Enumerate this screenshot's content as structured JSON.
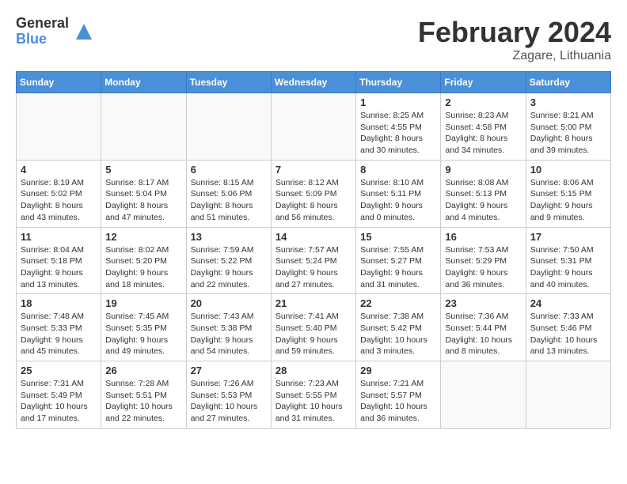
{
  "logo": {
    "general": "General",
    "blue": "Blue"
  },
  "title": {
    "month_year": "February 2024",
    "location": "Zagare, Lithuania"
  },
  "weekdays": [
    "Sunday",
    "Monday",
    "Tuesday",
    "Wednesday",
    "Thursday",
    "Friday",
    "Saturday"
  ],
  "weeks": [
    [
      {
        "day": "",
        "info": ""
      },
      {
        "day": "",
        "info": ""
      },
      {
        "day": "",
        "info": ""
      },
      {
        "day": "",
        "info": ""
      },
      {
        "day": "1",
        "info": "Sunrise: 8:25 AM\nSunset: 4:55 PM\nDaylight: 8 hours\nand 30 minutes."
      },
      {
        "day": "2",
        "info": "Sunrise: 8:23 AM\nSunset: 4:58 PM\nDaylight: 8 hours\nand 34 minutes."
      },
      {
        "day": "3",
        "info": "Sunrise: 8:21 AM\nSunset: 5:00 PM\nDaylight: 8 hours\nand 39 minutes."
      }
    ],
    [
      {
        "day": "4",
        "info": "Sunrise: 8:19 AM\nSunset: 5:02 PM\nDaylight: 8 hours\nand 43 minutes."
      },
      {
        "day": "5",
        "info": "Sunrise: 8:17 AM\nSunset: 5:04 PM\nDaylight: 8 hours\nand 47 minutes."
      },
      {
        "day": "6",
        "info": "Sunrise: 8:15 AM\nSunset: 5:06 PM\nDaylight: 8 hours\nand 51 minutes."
      },
      {
        "day": "7",
        "info": "Sunrise: 8:12 AM\nSunset: 5:09 PM\nDaylight: 8 hours\nand 56 minutes."
      },
      {
        "day": "8",
        "info": "Sunrise: 8:10 AM\nSunset: 5:11 PM\nDaylight: 9 hours\nand 0 minutes."
      },
      {
        "day": "9",
        "info": "Sunrise: 8:08 AM\nSunset: 5:13 PM\nDaylight: 9 hours\nand 4 minutes."
      },
      {
        "day": "10",
        "info": "Sunrise: 8:06 AM\nSunset: 5:15 PM\nDaylight: 9 hours\nand 9 minutes."
      }
    ],
    [
      {
        "day": "11",
        "info": "Sunrise: 8:04 AM\nSunset: 5:18 PM\nDaylight: 9 hours\nand 13 minutes."
      },
      {
        "day": "12",
        "info": "Sunrise: 8:02 AM\nSunset: 5:20 PM\nDaylight: 9 hours\nand 18 minutes."
      },
      {
        "day": "13",
        "info": "Sunrise: 7:59 AM\nSunset: 5:22 PM\nDaylight: 9 hours\nand 22 minutes."
      },
      {
        "day": "14",
        "info": "Sunrise: 7:57 AM\nSunset: 5:24 PM\nDaylight: 9 hours\nand 27 minutes."
      },
      {
        "day": "15",
        "info": "Sunrise: 7:55 AM\nSunset: 5:27 PM\nDaylight: 9 hours\nand 31 minutes."
      },
      {
        "day": "16",
        "info": "Sunrise: 7:53 AM\nSunset: 5:29 PM\nDaylight: 9 hours\nand 36 minutes."
      },
      {
        "day": "17",
        "info": "Sunrise: 7:50 AM\nSunset: 5:31 PM\nDaylight: 9 hours\nand 40 minutes."
      }
    ],
    [
      {
        "day": "18",
        "info": "Sunrise: 7:48 AM\nSunset: 5:33 PM\nDaylight: 9 hours\nand 45 minutes."
      },
      {
        "day": "19",
        "info": "Sunrise: 7:45 AM\nSunset: 5:35 PM\nDaylight: 9 hours\nand 49 minutes."
      },
      {
        "day": "20",
        "info": "Sunrise: 7:43 AM\nSunset: 5:38 PM\nDaylight: 9 hours\nand 54 minutes."
      },
      {
        "day": "21",
        "info": "Sunrise: 7:41 AM\nSunset: 5:40 PM\nDaylight: 9 hours\nand 59 minutes."
      },
      {
        "day": "22",
        "info": "Sunrise: 7:38 AM\nSunset: 5:42 PM\nDaylight: 10 hours\nand 3 minutes."
      },
      {
        "day": "23",
        "info": "Sunrise: 7:36 AM\nSunset: 5:44 PM\nDaylight: 10 hours\nand 8 minutes."
      },
      {
        "day": "24",
        "info": "Sunrise: 7:33 AM\nSunset: 5:46 PM\nDaylight: 10 hours\nand 13 minutes."
      }
    ],
    [
      {
        "day": "25",
        "info": "Sunrise: 7:31 AM\nSunset: 5:49 PM\nDaylight: 10 hours\nand 17 minutes."
      },
      {
        "day": "26",
        "info": "Sunrise: 7:28 AM\nSunset: 5:51 PM\nDaylight: 10 hours\nand 22 minutes."
      },
      {
        "day": "27",
        "info": "Sunrise: 7:26 AM\nSunset: 5:53 PM\nDaylight: 10 hours\nand 27 minutes."
      },
      {
        "day": "28",
        "info": "Sunrise: 7:23 AM\nSunset: 5:55 PM\nDaylight: 10 hours\nand 31 minutes."
      },
      {
        "day": "29",
        "info": "Sunrise: 7:21 AM\nSunset: 5:57 PM\nDaylight: 10 hours\nand 36 minutes."
      },
      {
        "day": "",
        "info": ""
      },
      {
        "day": "",
        "info": ""
      }
    ]
  ]
}
